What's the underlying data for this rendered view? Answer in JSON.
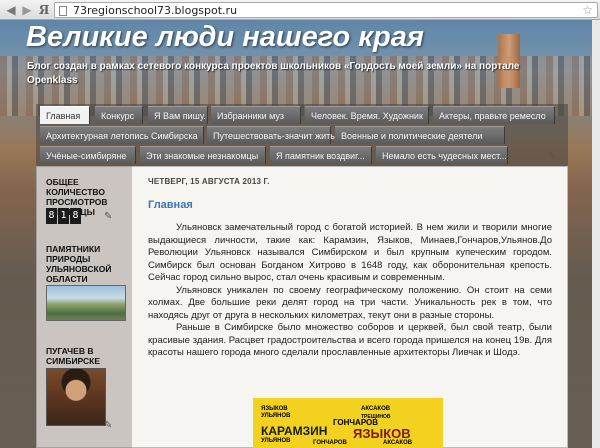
{
  "browser": {
    "url": "73regionschool73.blogspot.ru",
    "logo_char": "Я"
  },
  "header": {
    "title": "Великие люди нашего края",
    "description": "Блог создан в рамках сетевого конкурса проектов школьников «Гордость моей земли» на портале Openklass"
  },
  "tabs": [
    "Главная",
    "Конкурс",
    "Я Вам пишу.",
    "Избранники муз",
    "Человек. Время. Художник",
    "Актеры, правьте ремесло",
    "Архитектурная летопись Симбирска",
    "Путешествовать-значит жить.",
    "Военные и политические деятели",
    "Учёные-симбиряне",
    "Эти знакомые незнакомцы",
    "Я памятник воздвиг...",
    "Немало есть чудесных мест..."
  ],
  "sidebar": {
    "counter_title": "ОБЩЕЕ КОЛИЧЕСТВО ПРОСМОТРОВ СТРАНИЦЫ",
    "counter_digits": [
      "8",
      "1",
      "8"
    ],
    "nature_title": "ПАМЯТНИКИ ПРИРОДЫ УЛЬЯНОВСКОЙ ОБЛАСТИ",
    "pugachev_title": "ПУГАЧЕВ В СИМБИРСКЕ"
  },
  "post": {
    "date": "ЧЕТВЕРГ, 15 АВГУСТА 2013 Г.",
    "title": "Главная",
    "paragraphs": [
      "Ульяновск замечательный город с богатой историей. В нем жили и творили многие выдающиеся личности, такие как: Карамзин, Языков, Минаев,Гончаров,Ульянов.До Революции Ульяновск назывался Симбирском и был крупным купеческим городом. Симбирск был основан Богданом Хитрово в 1648 году, как оборонительная крепость. Сейчас город сильно вырос, стал очень красивым и современным.",
      "Ульяновск уникален по своему географическому положению. Он стоит на семи холмах. Две большие реки делят город на три части. Уникальность рек в том, что находясь друг от друга в нескольких километрах, текут они в разные стороны.",
      "Раньше в Симбирске было множество соборов и церквей, был свой театр, были красивые здания. Расцвет градостроительства и всего города пришелся на конец 19в. Для красоты нашего города много сделали прославленные архитекторы Ливчак и Шодэ."
    ]
  },
  "book_names": [
    "ЯЗЫКОВ",
    "УЛЬЯНОВ",
    "АКСАКОВ",
    "ГОНЧАРОВ",
    "КАРАМЗИН",
    "ЯЗЫКОВ",
    "ТРЕЩИНОВ",
    "УЛЬЯНОВ",
    "ГОНЧАРОВ",
    "АКСАКОВ"
  ]
}
